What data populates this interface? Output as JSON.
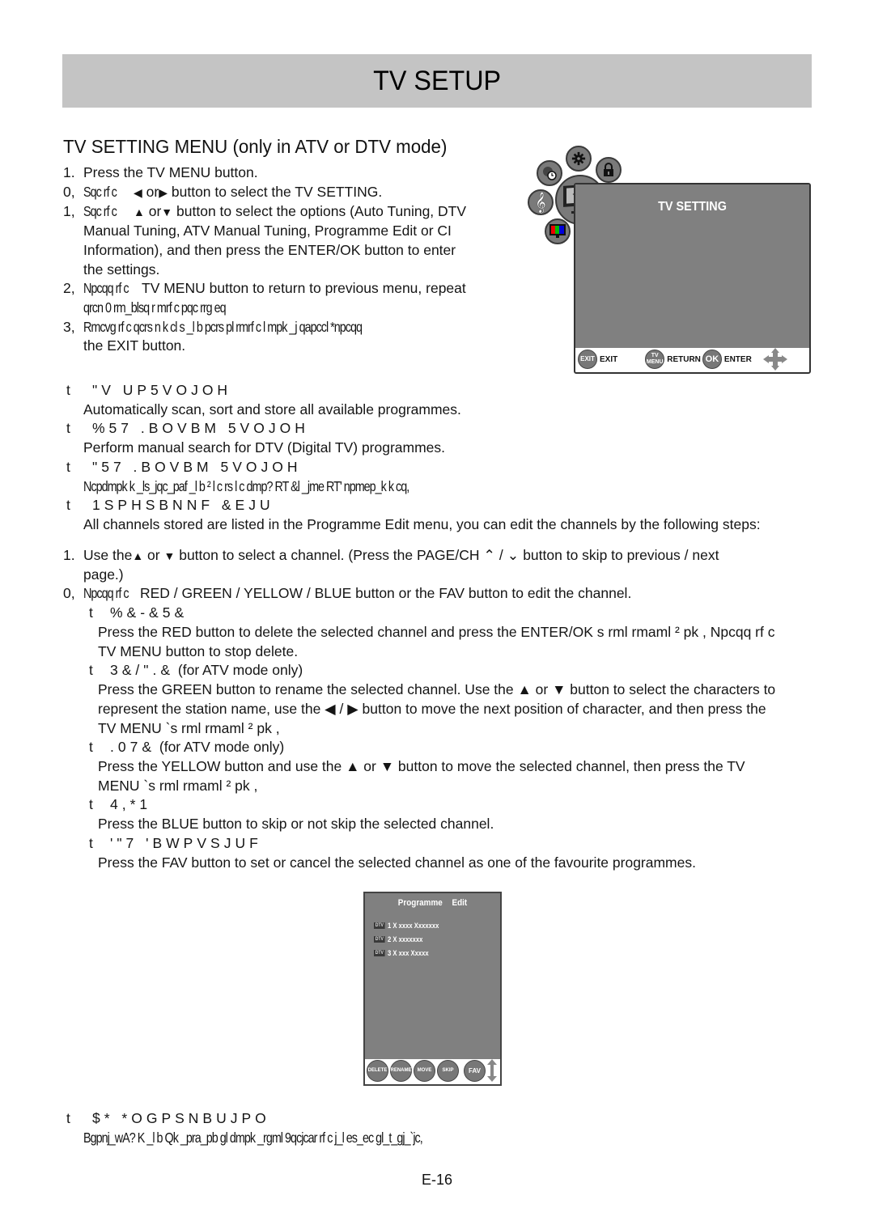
{
  "header": {
    "title": "TV SETUP"
  },
  "section": {
    "title": "TV SETTING MENU (only in ATV or DTV mode)"
  },
  "steps": [
    {
      "num": "1.",
      "lines": [
        "Press the TV MENU button."
      ]
    },
    {
      "num": "0,",
      "prefix": "Sqc rf c",
      "mid": "or",
      "rest": "button to select the TV SETTING."
    },
    {
      "num": "1,",
      "prefix": "Sqc rf c",
      "mid": "or",
      "rest": "button to select the options (Auto Tuning, DTV",
      "cont": [
        "Manual Tuning, ATV Manual Tuning, Programme Edit or CI",
        "Information), and then press the ENTER/OK button to enter",
        "the settings."
      ]
    },
    {
      "num": "2,",
      "prefix": "Npcqq rf c",
      "rest": "TV MENU button to return to previous menu, repeat",
      "cont_scrambled": "qrcn 0 rm_blsq r mrf c pqc rrg eq"
    },
    {
      "num": "3,",
      "scrambled": "Rmcvg rf c qcrs n k cl s _l b pcrs pl  rmrf c l mpk _j qapccl *npcqq",
      "cont": [
        "the EXIT button."
      ]
    }
  ],
  "tv_setting_osd": {
    "title": "TV SETTING",
    "icons": [
      "gear-icon",
      "clock-globe-icon",
      "lock-icon",
      "music-note-icon",
      "tv-icon",
      "color-bars-icon"
    ],
    "tv_icon_label": "TV",
    "footer": [
      {
        "key": "EXIT",
        "label": "EXIT"
      },
      {
        "key": "TV MENU",
        "label": "RETURN"
      },
      {
        "key": "OK",
        "label": "ENTER"
      }
    ]
  },
  "options": [
    {
      "bullet": "t",
      "title": "\"V UP5VOJOH",
      "desc": "Automatically scan, sort and store all available programmes."
    },
    {
      "bullet": "t",
      "title": "%57 .BOVBM 5VOJOH",
      "desc": "Perform manual search for DTV (Digital TV) programmes."
    },
    {
      "bullet": "t",
      "title": "\"57 .BOVBM 5VOJOH",
      "desc": "Ncpdmpk k _ls_jqc_paf _l b ² l c rs l c dmp? RT &l _jme RT' npmep_k k cq,"
    },
    {
      "bullet": "t",
      "title": "1SPHSBNNF &EJU",
      "desc": "All channels stored are listed in the Programme Edit menu, you can edit the channels by the following steps:"
    }
  ],
  "edit_steps": {
    "step1": {
      "num": "1.",
      "text_a": "Use the",
      "text_b": "or",
      "text_c": "button to select a channel. (Press the PAGE/CH",
      "text_d": "/",
      "text_e": "button to skip to previous / next",
      "cont": "page.)"
    },
    "step2": {
      "num": "0,",
      "prefix": "Npcqq rf c",
      "text": "RED / GREEN / YELLOW / BLUE button or the FAV button to edit the channel."
    }
  },
  "edit_items": [
    {
      "title": "%&-&5&",
      "note": "",
      "lines": [
        "Press the RED button to delete the selected channel and press the ENTER/OK s rml  rmaml ² pk , Npcqq rf c",
        "TV MENU button to stop delete."
      ]
    },
    {
      "title": "3&/\".&",
      "note": "(for ATV mode only)",
      "lines": [
        "Press the GREEN button to rename the selected channel. Use the ▲ or ▼ button to select the characters to",
        "represent the station name, use the ◀ / ▶ button to move the next position of character, and then press the",
        "TV MENU `s rml  rmaml ² pk ,"
      ]
    },
    {
      "title": ".07&",
      "note": "(for ATV mode only)",
      "lines": [
        "Press the YELLOW button and use the ▲ or ▼ button to move the selected channel, then press the TV",
        "MENU `s rml  rmaml ² pk ,"
      ]
    },
    {
      "title": "4,*1",
      "note": "",
      "lines": [
        "Press the BLUE button to skip or not skip the selected channel."
      ]
    },
    {
      "title": "'\"7 'BWPVSJUF",
      "note": "",
      "lines": [
        "Press the FAV button to set or cancel the selected channel as one of the favourite programmes."
      ]
    }
  ],
  "programme_edit_osd": {
    "title": "Programme Edit",
    "channels": [
      {
        "badge": "DTV",
        "name": "1 X xxxx  Xxxxxxx"
      },
      {
        "badge": "DTV",
        "name": "2 X xxxxxxx"
      },
      {
        "badge": "DTV",
        "name": "3 X xxx  Xxxxx"
      }
    ],
    "buttons": [
      "DELETE",
      "RENAME",
      "MOVE",
      "SKIP",
      "FAV"
    ]
  },
  "ci_info": {
    "bullet": "t",
    "title": "$* *OGPSNBUJPO",
    "desc": "Bgpnj_wA? K _l b Qk _pra_pb gl dmpk _rgml 9qcjcar rf c j_l es_ec gl_t_gj_`jc,"
  },
  "page_number": "E-16"
}
